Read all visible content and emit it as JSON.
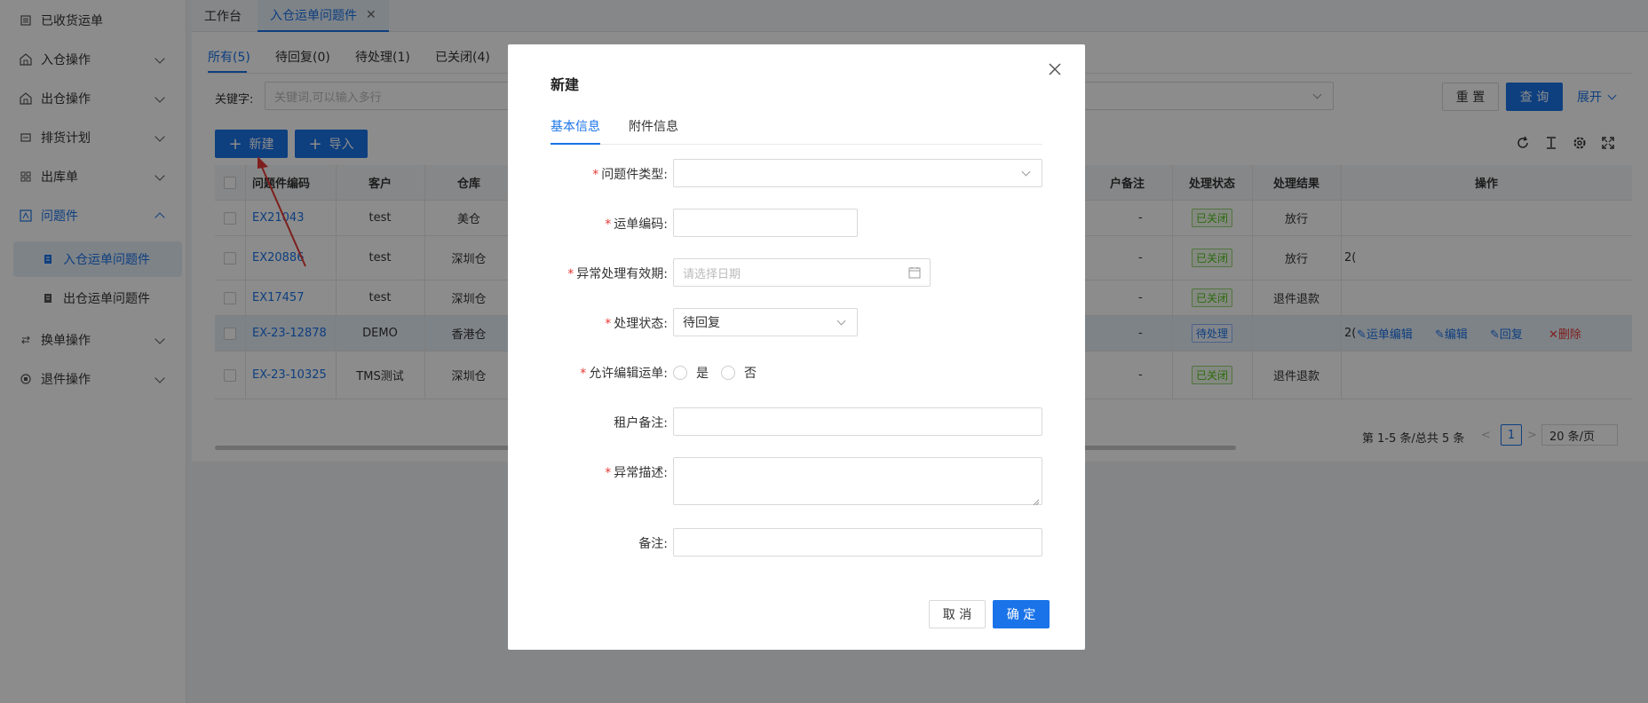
{
  "sidebar": {
    "items": [
      {
        "label": "已收货运单",
        "icon": "list-icon",
        "expand": "none"
      },
      {
        "label": "入仓操作",
        "icon": "warehouse-in-icon",
        "expand": "down"
      },
      {
        "label": "出仓操作",
        "icon": "warehouse-out-icon",
        "expand": "down"
      },
      {
        "label": "排货计划",
        "icon": "plan-icon",
        "expand": "down"
      },
      {
        "label": "出库单",
        "icon": "grid-icon",
        "expand": "down"
      },
      {
        "label": "问题件",
        "icon": "problem-icon",
        "expand": "up"
      },
      {
        "label": "换单操作",
        "icon": "swap-icon",
        "expand": "down"
      },
      {
        "label": "退件操作",
        "icon": "return-icon",
        "expand": "down"
      }
    ],
    "submenu": [
      {
        "label": "入仓运单问题件",
        "icon": "doc-icon"
      },
      {
        "label": "出仓运单问题件",
        "icon": "doc-icon"
      }
    ]
  },
  "tabs": {
    "workbench": "工作台",
    "current": "入仓运单问题件",
    "close": "✕"
  },
  "filters": {
    "all": "所有(5)",
    "awaiting_reply": "待回复(0)",
    "pending": "待处理(1)",
    "closed": "已关闭(4)"
  },
  "search": {
    "label": "关键字:",
    "placeholder": "关键词,可以输入多行",
    "reset": "重 置",
    "query": "查 询",
    "expand": "展开"
  },
  "toolbar": {
    "new": "新建",
    "import": "导入",
    "plus": "+"
  },
  "table": {
    "headers": {
      "code": "问题件编码",
      "customer": "客户",
      "warehouse": "仓库",
      "remark": "户备注",
      "status": "处理状态",
      "result": "处理结果",
      "ops": "操作"
    },
    "rows": [
      {
        "code": "EX21043",
        "customer": "test",
        "warehouse": "美仓",
        "remark": "-",
        "status": "已关闭",
        "result": "放行",
        "extra": ""
      },
      {
        "code": "EX20886",
        "customer": "test",
        "warehouse": "深圳仓",
        "remark": "-",
        "status": "已关闭",
        "result": "放行",
        "extra": "2("
      },
      {
        "code": "EX17457",
        "customer": "test",
        "warehouse": "深圳仓",
        "remark": "-",
        "status": "已关闭",
        "result": "退件退款",
        "extra": ""
      },
      {
        "code": "EX-23-12878",
        "customer": "DEMO",
        "warehouse": "香港仓",
        "remark": "-",
        "status": "待处理",
        "result": "",
        "extra": "2("
      },
      {
        "code": "EX-23-10325",
        "customer": "TMS测试",
        "warehouse": "深圳仓",
        "remark": "-",
        "status": "已关闭",
        "result": "退件退款",
        "extra": ""
      }
    ],
    "ops": {
      "edit_waybill": "运单编辑",
      "edit": "编辑",
      "reply": "回复",
      "delete": "删除"
    }
  },
  "pager": {
    "summary": "第 1-5 条/总共 5 条",
    "page": "1",
    "size": "20 条/页",
    "prev": "<",
    "next": ">"
  },
  "modal": {
    "title": "新建",
    "tabs": {
      "basic": "基本信息",
      "attachments": "附件信息"
    },
    "fields": {
      "type": {
        "label": "问题件类型:",
        "value": ""
      },
      "waybill": {
        "label": "运单编码:",
        "value": ""
      },
      "validity": {
        "label": "异常处理有效期:",
        "placeholder": "请选择日期"
      },
      "status": {
        "label": "处理状态:",
        "value": "待回复"
      },
      "allow_edit": {
        "label": "允许编辑运单:",
        "yes": "是",
        "no": "否"
      },
      "tenant_remark": {
        "label": "租户备注:",
        "value": ""
      },
      "description": {
        "label": "异常描述:",
        "value": ""
      },
      "remark": {
        "label": "备注:",
        "value": ""
      }
    },
    "required_mark": "*",
    "cancel": "取 消",
    "confirm": "确 定"
  },
  "colors": {
    "primary": "#1a73e8",
    "danger": "#e53935",
    "success": "#52c41a",
    "annotation_arrow": "#e53935"
  }
}
